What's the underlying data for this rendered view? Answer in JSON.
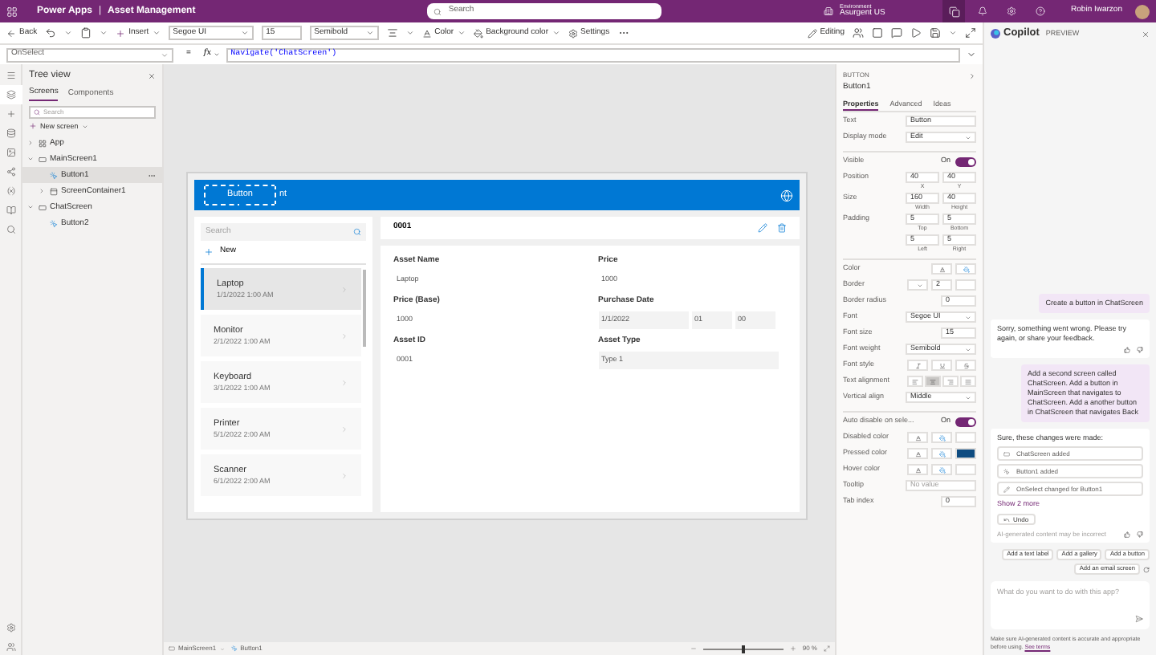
{
  "app_bar": {
    "product": "Power Apps",
    "separator": "|",
    "app_name": "Asset Management",
    "search_placeholder": "Search",
    "environment_label": "Environment",
    "environment": "Asurgent US",
    "user": "Robin Iwarzon"
  },
  "toolbar": {
    "back": "Back",
    "insert": "Insert",
    "font": "Segoe UI",
    "font_size": "15",
    "font_weight": "Semibold",
    "color_label": "Color",
    "background_color_label": "Background color",
    "settings": "Settings",
    "editing": "Editing"
  },
  "formula_bar": {
    "property": "OnSelect",
    "equals": "=",
    "fx": "fx",
    "formula": "Navigate('ChatScreen')"
  },
  "rail": [
    {
      "kind": "menu",
      "selected": false
    },
    {
      "kind": "tree",
      "selected": true
    },
    {
      "kind": "insert",
      "selected": false
    },
    {
      "kind": "data",
      "selected": false
    },
    {
      "kind": "media",
      "selected": false
    },
    {
      "kind": "flow",
      "selected": false
    },
    {
      "kind": "variables",
      "selected": false
    },
    {
      "kind": "library",
      "selected": false
    },
    {
      "kind": "search",
      "selected": false
    }
  ],
  "tree_view": {
    "title": "Tree view",
    "tabs": [
      {
        "label": "Screens",
        "selected": true
      },
      {
        "label": "Components",
        "selected": false
      }
    ],
    "search_placeholder": "Search",
    "new_screen": "New screen",
    "items": [
      {
        "kind": "app",
        "label": "App",
        "expanded": false,
        "selected": false
      },
      {
        "kind": "screen",
        "label": "MainScreen1",
        "expanded": true,
        "selected": false,
        "children": [
          {
            "kind": "button",
            "label": "Button1",
            "selected": true
          },
          {
            "kind": "container",
            "label": "ScreenContainer1",
            "expanded": false,
            "selected": false
          }
        ]
      },
      {
        "kind": "screen",
        "label": "ChatScreen",
        "expanded": true,
        "selected": false,
        "children": [
          {
            "kind": "button",
            "label": "Button2",
            "selected": false
          }
        ]
      }
    ]
  },
  "canvas": {
    "header": {
      "button_label": "Button",
      "title_visible": "nt"
    },
    "gallery": {
      "search_placeholder": "Search",
      "new": "New",
      "items": [
        {
          "title": "Laptop",
          "date": "1/1/2022 1:00 AM",
          "selected": true
        },
        {
          "title": "Monitor",
          "date": "2/1/2022 1:00 AM",
          "selected": false
        },
        {
          "title": "Keyboard",
          "date": "3/1/2022 1:00 AM",
          "selected": false
        },
        {
          "title": "Printer",
          "date": "5/1/2022 2:00 AM",
          "selected": false
        },
        {
          "title": "Scanner",
          "date": "6/1/2022 2:00 AM",
          "selected": false
        }
      ]
    },
    "detail": {
      "id": "0001",
      "fields": [
        {
          "label": "Asset Name",
          "kind": "text",
          "values": [
            "Laptop"
          ]
        },
        {
          "label": "Price",
          "kind": "text",
          "values": [
            "1000"
          ]
        },
        {
          "label": "Price (Base)",
          "kind": "text",
          "values": [
            "1000"
          ]
        },
        {
          "label": "Purchase Date",
          "kind": "datetime",
          "values": [
            "1/1/2022",
            "01",
            "00"
          ]
        },
        {
          "label": "Asset ID",
          "kind": "text",
          "values": [
            "0001"
          ]
        },
        {
          "label": "Asset Type",
          "kind": "input",
          "values": [
            "Type 1"
          ]
        }
      ]
    }
  },
  "status_bar": {
    "screen": "MainScreen1",
    "control": "Button1",
    "level": 0.5,
    "zoom": "90 %"
  },
  "properties": {
    "type": "BUTTON",
    "name": "Button1",
    "tabs": [
      {
        "label": "Properties",
        "selected": true
      },
      {
        "label": "Advanced",
        "selected": false
      },
      {
        "label": "Ideas",
        "selected": false
      }
    ],
    "sections": [
      {
        "rows": [
          {
            "kind": "input",
            "label": "Text",
            "value": "Button"
          },
          {
            "kind": "dropdown",
            "label": "Display mode",
            "value": "Edit"
          }
        ]
      },
      {
        "rows": [
          {
            "kind": "toggle",
            "label": "Visible",
            "value": "On",
            "on": true
          },
          {
            "kind": "pair",
            "label": "Position",
            "fields": [
              {
                "value": "40",
                "caption": "X"
              },
              {
                "value": "40",
                "caption": "Y"
              }
            ]
          },
          {
            "kind": "pair",
            "label": "Size",
            "fields": [
              {
                "value": "160",
                "caption": "Width"
              },
              {
                "value": "40",
                "caption": "Height"
              }
            ]
          },
          {
            "kind": "pair",
            "label": "Padding",
            "fields": [
              {
                "value": "5",
                "caption": "Top"
              },
              {
                "value": "5",
                "caption": "Bottom"
              }
            ]
          },
          {
            "kind": "pair",
            "label": "",
            "fields": [
              {
                "value": "5",
                "caption": "Left"
              },
              {
                "value": "5",
                "caption": "Right"
              }
            ]
          }
        ]
      },
      {
        "rows": [
          {
            "kind": "colors",
            "label": "Color"
          },
          {
            "kind": "border",
            "label": "Border",
            "value": "2",
            "color": "#ffffff"
          },
          {
            "kind": "number",
            "label": "Border radius",
            "value": "0"
          },
          {
            "kind": "dropdown",
            "label": "Font",
            "value": "Segoe UI"
          },
          {
            "kind": "number",
            "label": "Font size",
            "value": "15"
          },
          {
            "kind": "dropdown",
            "label": "Font weight",
            "value": "Semibold"
          },
          {
            "kind": "font_style",
            "label": "Font style",
            "options": [
              {
                "selected": false
              },
              {
                "selected": false
              },
              {
                "selected": false
              }
            ]
          },
          {
            "kind": "align",
            "label": "Text alignment",
            "options": [
              {
                "selected": false
              },
              {
                "selected": true
              },
              {
                "selected": false
              },
              {
                "selected": false
              }
            ]
          },
          {
            "kind": "dropdown",
            "label": "Vertical align",
            "value": "Middle"
          }
        ]
      },
      {
        "rows": [
          {
            "kind": "toggle",
            "label": "Auto disable on sele...",
            "value": "On",
            "on": true
          },
          {
            "kind": "colors",
            "label": "Disabled color",
            "color": "#ffffff"
          },
          {
            "kind": "colors",
            "label": "Pressed color",
            "color": "#0f4c81"
          },
          {
            "kind": "colors",
            "label": "Hover color",
            "color": "#ffffff"
          },
          {
            "kind": "input",
            "label": "Tooltip",
            "placeholder": "No value"
          },
          {
            "kind": "number",
            "label": "Tab index",
            "value": "0"
          }
        ]
      }
    ]
  },
  "copilot": {
    "title": "Copilot",
    "badge": "PREVIEW",
    "messages": [
      {
        "kind": "user",
        "text": "Create a button in ChatScreen"
      },
      {
        "kind": "bot",
        "text": "Sorry, something went wrong. Please try again, or share your feedback."
      },
      {
        "kind": "user",
        "text": "Add a second screen called ChatScreen. Add a button in MainScreen that navigates to ChatScreen. Add a another button in ChatScreen that navigates Back"
      },
      {
        "kind": "changes",
        "text": "Sure, these changes were made:",
        "changes": [
          {
            "kind": "screen",
            "text": "ChatScreen added"
          },
          {
            "kind": "button",
            "text": "Button1 added"
          },
          {
            "kind": "formula",
            "text": "OnSelect changed for Button1"
          }
        ],
        "show_more": "Show 2 more",
        "undo": "Undo",
        "disclaimer": "AI-generated content may be incorrect"
      }
    ],
    "suggestions": [
      "Add a text label",
      "Add a gallery",
      "Add a button",
      "Add an email screen"
    ],
    "input_placeholder": "What do you want to do with this app?",
    "footer": "Make sure AI-generated content is accurate and appropriate before using.",
    "footer_link": "See terms"
  }
}
